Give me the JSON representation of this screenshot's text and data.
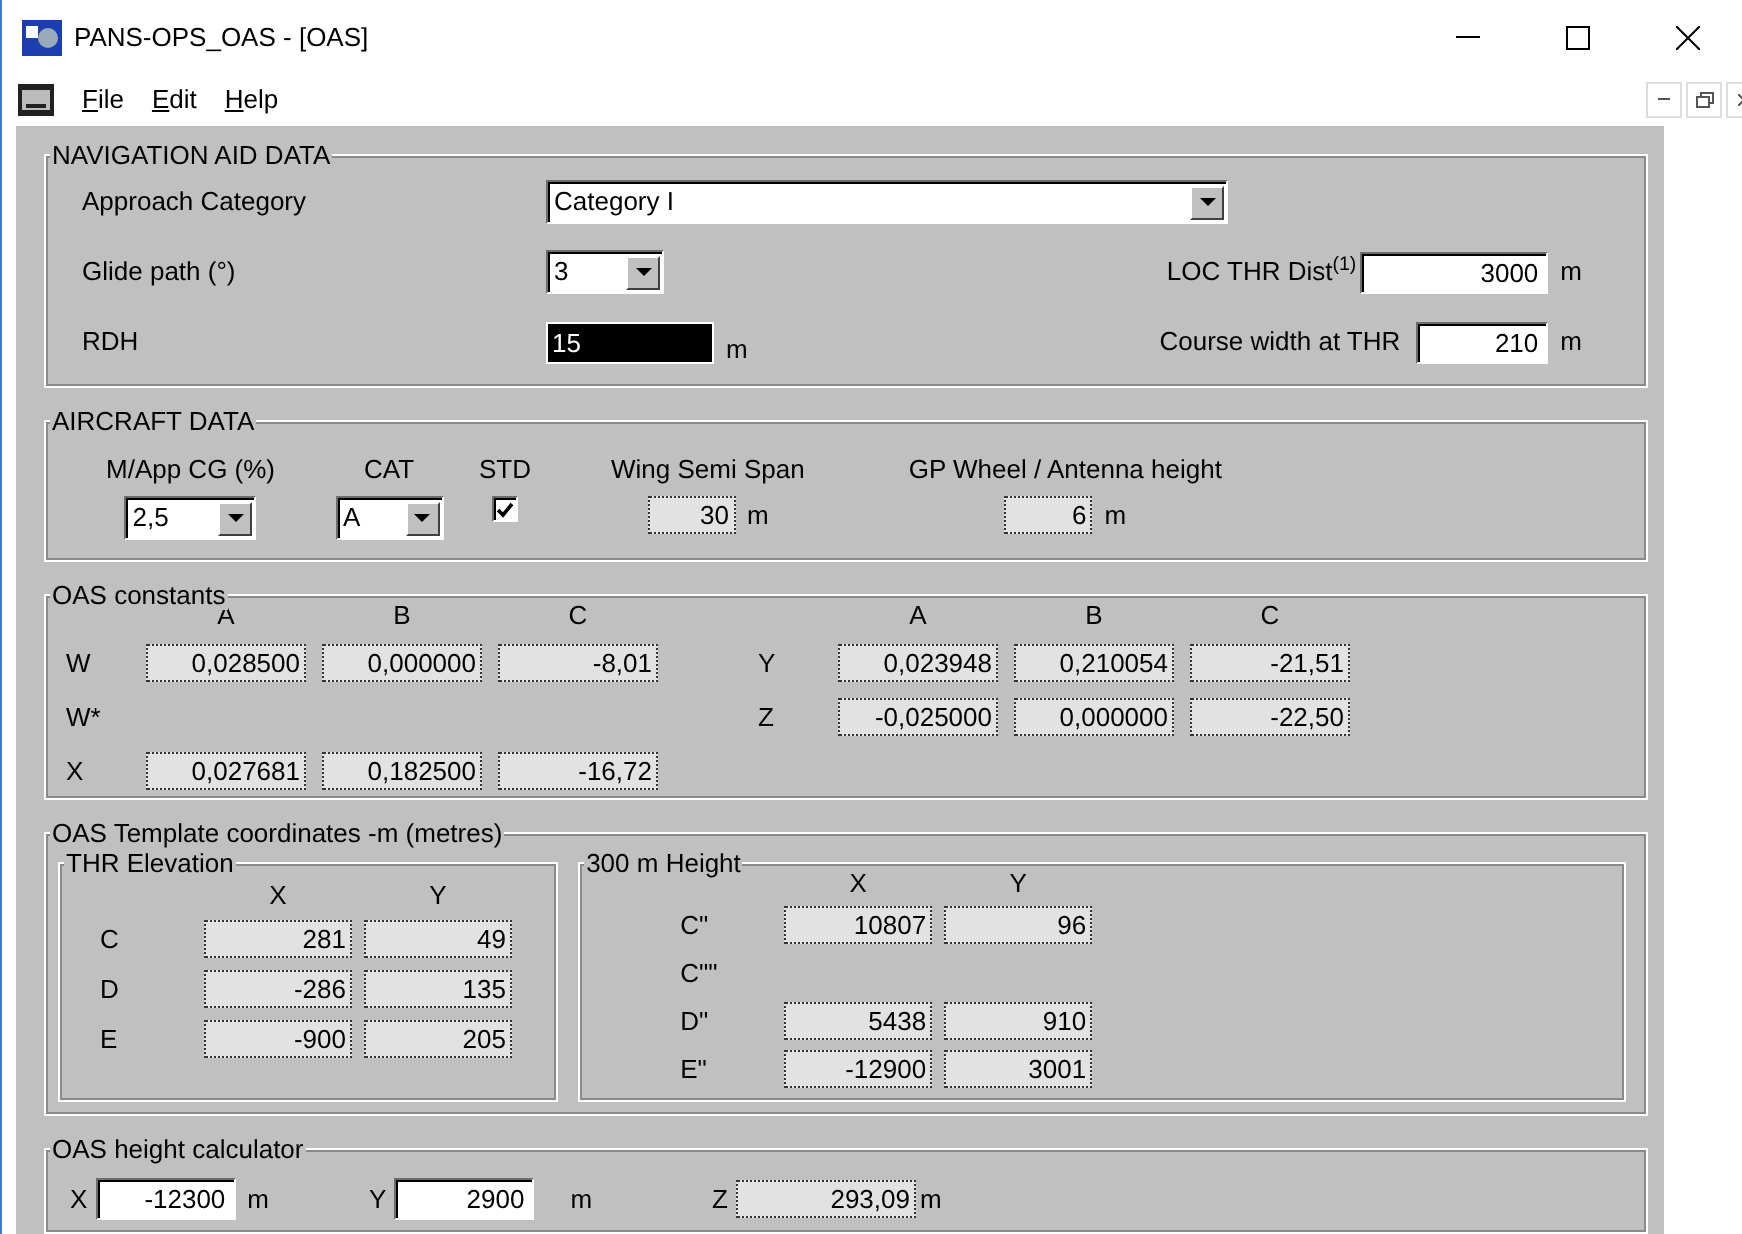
{
  "window": {
    "title": "PANS-OPS_OAS - [OAS]"
  },
  "menu": [
    "File",
    "Edit",
    "Help"
  ],
  "navigation_aid_data": {
    "title": "NAVIGATION AID DATA",
    "approach_category": {
      "label": "Approach Category",
      "value": "Category I"
    },
    "glide_path": {
      "label": "Glide path (°)",
      "value": "3"
    },
    "rdh": {
      "label": "RDH",
      "value": "15",
      "unit": "m",
      "selected": true
    },
    "loc_thr_dist": {
      "label": "LOC THR Dist$^{(1)}$",
      "value": "3000",
      "unit": "m"
    },
    "course_width": {
      "label": "Course width at THR",
      "value": "210",
      "unit": "m"
    }
  },
  "aircraft_data": {
    "title": "AIRCRAFT DATA",
    "columns": [
      {
        "kind": "dropdown",
        "label": "M/App CG (%)",
        "value": "2,5"
      },
      {
        "kind": "dropdown",
        "label": "CAT",
        "value": "A"
      },
      {
        "kind": "checkbox",
        "label": "STD",
        "checked": true
      },
      {
        "kind": "readonly",
        "label": "Wing Semi Span",
        "value": "30",
        "unit": "m"
      },
      {
        "kind": "readonly",
        "label": "GP Wheel / Antenna height",
        "value": "6",
        "unit": "m"
      }
    ]
  },
  "oas_constants": {
    "title": "OAS constants",
    "left_columns": [
      "A",
      "B",
      "C"
    ],
    "right_columns": [
      "A",
      "B",
      "C"
    ],
    "left_rows": [
      {
        "label": "W",
        "values": [
          "0,028500",
          "0,000000",
          "-8,01"
        ]
      },
      {
        "label": "W*",
        "values": []
      },
      {
        "label": "X",
        "values": [
          "0,027681",
          "0,182500",
          "-16,72"
        ]
      }
    ],
    "right_rows": [
      {
        "label": "Y",
        "values": [
          "0,023948",
          "0,210054",
          "-21,51"
        ]
      },
      {
        "label": "Z",
        "values": [
          "-0,025000",
          "0,000000",
          "-22,50"
        ]
      }
    ]
  },
  "oas_template": {
    "title": "OAS Template coordinates -m (metres)",
    "groups": [
      {
        "title": "THR Elevation",
        "columns": [
          "X",
          "Y"
        ],
        "rows": [
          {
            "label": "C",
            "values": [
              "281",
              "49"
            ]
          },
          {
            "label": "D",
            "values": [
              "-286",
              "135"
            ]
          },
          {
            "label": "E",
            "values": [
              "-900",
              "205"
            ]
          }
        ]
      },
      {
        "title": "300 m Height",
        "columns": [
          "X",
          "Y"
        ],
        "rows": [
          {
            "label": "C\"",
            "values": [
              "10807",
              "96"
            ]
          },
          {
            "label": "C\"\"",
            "values": []
          },
          {
            "label": "D\"",
            "values": [
              "5438",
              "910"
            ]
          },
          {
            "label": "E\"",
            "values": [
              "-12900",
              "3001"
            ]
          }
        ]
      }
    ]
  },
  "oas_height_calculator": {
    "title": "OAS height calculator",
    "fields": [
      {
        "kind": "input",
        "label": "X",
        "value": "-12300",
        "unit": "m"
      },
      {
        "kind": "input",
        "label": "Y",
        "value": "2900",
        "unit": "m"
      },
      {
        "kind": "readonly",
        "label": "Z",
        "value": "293,09",
        "unit": "m"
      }
    ]
  }
}
